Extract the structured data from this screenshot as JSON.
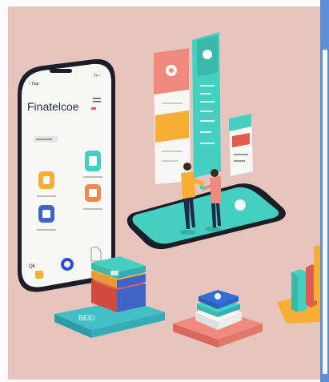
{
  "phone_app": {
    "status_left": "‹ Tiap",
    "status_right": "· Ti •",
    "title": "Finatelcoe",
    "bottom_label": "Q€"
  },
  "receipt_label": "BEEI",
  "colors": {
    "background": "#e8c4bf",
    "teal": "#45cfc0",
    "coral": "#f08a7e",
    "orange": "#f6ae35",
    "navy": "#274a73",
    "phone_frame": "#1b1e26",
    "accent_blue": "#5b8ed6"
  },
  "icons": [
    "shield-icon",
    "card-icon",
    "chart-icon",
    "wallet-icon",
    "pie-icon",
    "home-icon",
    "location-pin-icon",
    "people-icon"
  ]
}
